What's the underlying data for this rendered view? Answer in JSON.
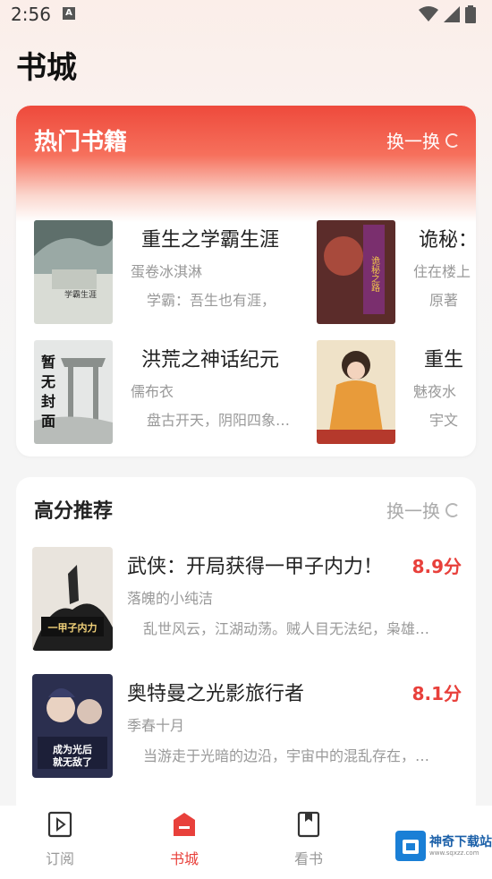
{
  "status_bar": {
    "time": "2:56",
    "notif": "A"
  },
  "page_title": "书城",
  "hot": {
    "title": "热门书籍",
    "refresh_label": "换一换",
    "books": [
      {
        "name": "重生之学霸生涯",
        "author": "蛋卷冰淇淋",
        "desc": "学霸：吾生也有涯，",
        "cover_text": "重生之学霸生涯"
      },
      {
        "name": "诡秘：",
        "author": "住在楼上",
        "desc": "原著",
        "cover_text": "诡秘的自己之路"
      },
      {
        "name": "洪荒之神话纪元",
        "author": "儒布衣",
        "desc": "盘古开天，阴阳四象…",
        "cover_text": "暂无封面"
      },
      {
        "name": "重生",
        "author": "魅夜水",
        "desc": "宇文",
        "cover_text": ""
      }
    ]
  },
  "recommend": {
    "title": "高分推荐",
    "refresh_label": "换一换",
    "books": [
      {
        "name": "武侠：开局获得一甲子内力！",
        "score": "8.9分",
        "author": "落魄的小纯洁",
        "desc": "乱世风云，江湖动荡。贼人目无法纪，枭雄…",
        "cover_text": "开局获得一甲子内力"
      },
      {
        "name": "奥特曼之光影旅行者",
        "score": "8.1分",
        "author": "季春十月",
        "desc": "当游走于光暗的边沿，宇宙中的混乱存在，…",
        "cover_text": "成为光后就无敌了"
      }
    ]
  },
  "nav": {
    "items": [
      {
        "label": "订阅"
      },
      {
        "label": "书城"
      },
      {
        "label": "看书"
      }
    ]
  },
  "watermark": {
    "text": "神奇下载站",
    "sub": "www.sqxzz.com"
  },
  "colors": {
    "accent": "#e8403b",
    "header_red": "#ee4a3c"
  }
}
